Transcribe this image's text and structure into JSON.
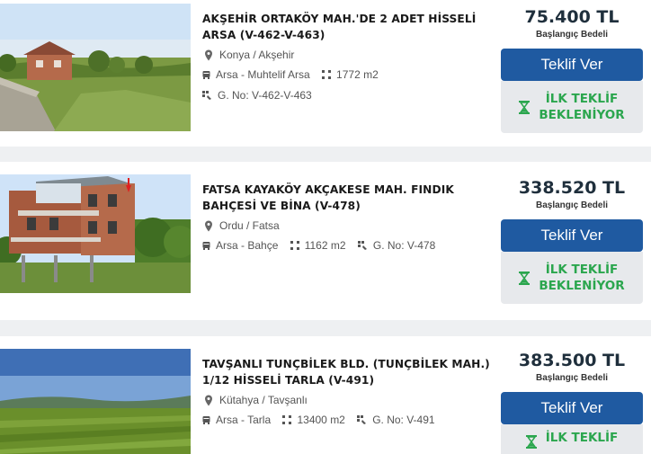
{
  "listings": [
    {
      "title": "AKŞEHİR ORTAKÖY MAH.'DE 2 ADET HİSSELİ ARSA (V-462-V-463)",
      "location": "Konya / Akşehir",
      "category": "Arsa - Muhtelif Arsa",
      "area": "1772 m2",
      "lot_no": "G. No: V-462-V-463",
      "price": "75.400 TL",
      "price_label": "Başlangıç Bedeli",
      "offer_button": "Teklif Ver",
      "status": "İLK TEKLİF BEKLENİYOR"
    },
    {
      "title": "FATSA KAYAKÖY AKÇAKESE MAH. FINDIK BAHÇESİ VE BİNA (V-478)",
      "location": "Ordu / Fatsa",
      "category": "Arsa - Bahçe",
      "area": "1162 m2",
      "lot_no": "G. No: V-478",
      "price": "338.520 TL",
      "price_label": "Başlangıç Bedeli",
      "offer_button": "Teklif Ver",
      "status": "İLK TEKLİF BEKLENİYOR"
    },
    {
      "title": "TAVŞANLI TUNÇBİLEK BLD. (TUNÇBİLEK MAH.) 1/12 HİSSELİ TARLA (V-491)",
      "location": "Kütahya / Tavşanlı",
      "category": "Arsa - Tarla",
      "area": "13400 m2",
      "lot_no": "G. No: V-491",
      "price": "383.500 TL",
      "price_label": "Başlangıç Bedeli",
      "offer_button": "Teklif Ver",
      "status": "İLK TEKLİF"
    }
  ],
  "icons": {
    "location": "map-pin-icon",
    "category": "land-icon",
    "area": "area-icon",
    "lot": "parcel-icon",
    "status": "hourglass-icon"
  },
  "colors": {
    "button": "#1f5aa1",
    "status_text": "#2ba64e",
    "price": "#1f2f3c"
  }
}
